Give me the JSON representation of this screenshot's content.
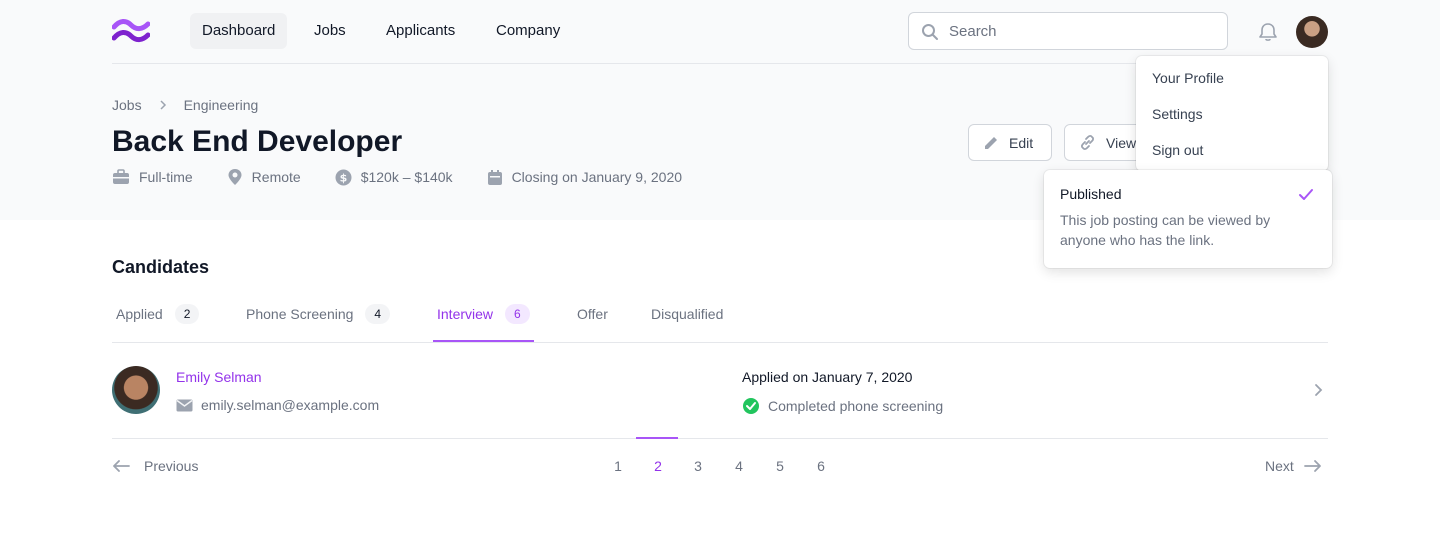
{
  "nav": {
    "links": [
      {
        "label": "Dashboard",
        "active": true
      },
      {
        "label": "Jobs",
        "active": false
      },
      {
        "label": "Applicants",
        "active": false
      },
      {
        "label": "Company",
        "active": false
      }
    ],
    "search_placeholder": "Search",
    "icons": [
      "logo-icon",
      "search-icon",
      "bell-icon"
    ]
  },
  "breadcrumb": [
    "Jobs",
    "Engineering"
  ],
  "job": {
    "title": "Back End Developer",
    "meta": [
      "Full-time",
      "Remote",
      "$120k – $140k",
      "Closing on January 9, 2020"
    ]
  },
  "actions": {
    "edit": "Edit",
    "view": "View"
  },
  "user_menu": [
    "Your Profile",
    "Settings",
    "Sign out"
  ],
  "publish_popover": {
    "title": "Published",
    "description": "This job posting can be viewed by anyone who has the link."
  },
  "candidates": {
    "title": "Candidates",
    "tabs": [
      {
        "label": "Applied",
        "count": "2",
        "active": false
      },
      {
        "label": "Phone Screening",
        "count": "4",
        "active": false
      },
      {
        "label": "Interview",
        "count": "6",
        "active": true
      },
      {
        "label": "Offer",
        "count": null,
        "active": false
      },
      {
        "label": "Disqualified",
        "count": null,
        "active": false
      }
    ],
    "rows": [
      {
        "name": "Emily Selman",
        "email": "emily.selman@example.com",
        "applied": "Applied on January 7, 2020",
        "status": "Completed phone screening"
      }
    ]
  },
  "pagination": {
    "previous": "Previous",
    "next": "Next",
    "pages": [
      "1",
      "2",
      "3",
      "4",
      "5",
      "6"
    ],
    "current": "2"
  },
  "colors": {
    "accent": "#9333ea",
    "success": "#22c55e",
    "muted": "#6b7280",
    "header_bg": "#f9fafb"
  }
}
